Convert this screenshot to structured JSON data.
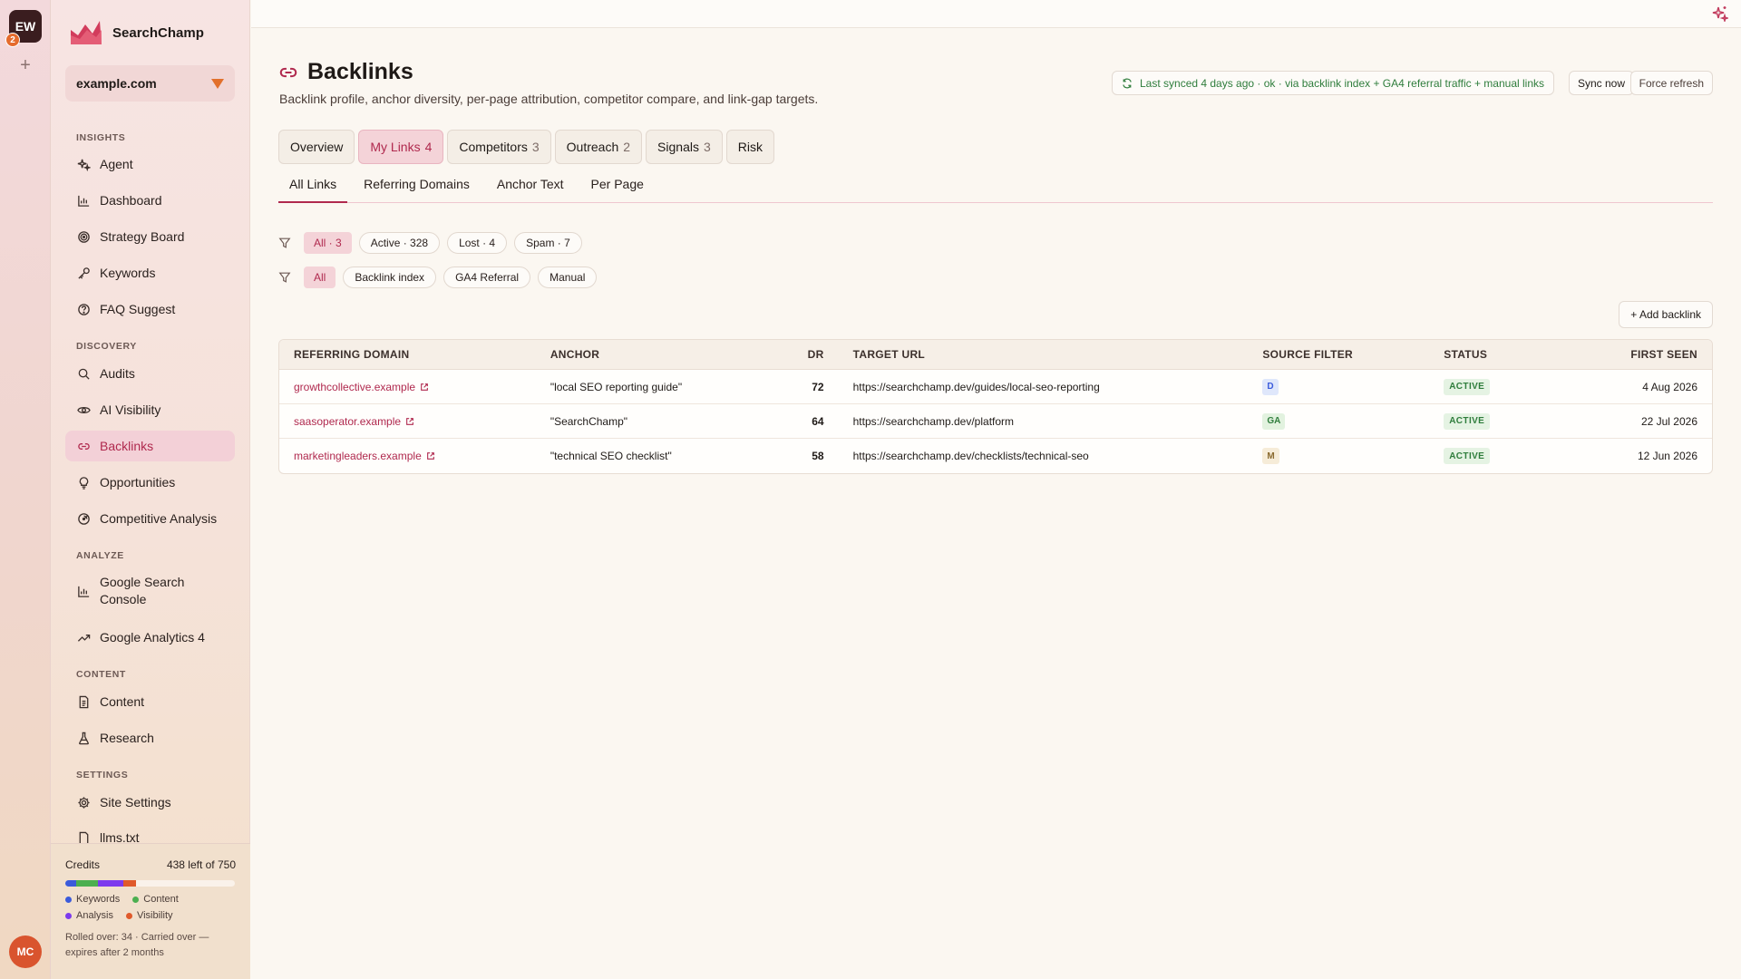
{
  "workspace": {
    "initials": "EW",
    "notifications": "2"
  },
  "user": {
    "initials": "MC"
  },
  "brand": {
    "name": "SearchChamp"
  },
  "site": {
    "selected": "example.com"
  },
  "nav": {
    "insights_label": "INSIGHTS",
    "discovery_label": "DISCOVERY",
    "analyze_label": "ANALYZE",
    "content_label": "CONTENT",
    "settings_label": "SETTINGS",
    "agent": "Agent",
    "dashboard": "Dashboard",
    "strategy": "Strategy Board",
    "keywords": "Keywords",
    "faq": "FAQ Suggest",
    "audits": "Audits",
    "ai_visibility": "AI Visibility",
    "backlinks": "Backlinks",
    "opportunities": "Opportunities",
    "competitive": "Competitive Analysis",
    "gsc_line1": "Google Search",
    "gsc_line2": "Console",
    "ga4": "Google Analytics 4",
    "content": "Content",
    "research": "Research",
    "site_settings": "Site Settings",
    "llms": "llms.txt"
  },
  "credits": {
    "label": "Credits",
    "remaining": "438 left of 750",
    "segments": [
      {
        "name": "Keywords",
        "fraction": 0.063,
        "color": "#3b5bdb"
      },
      {
        "name": "Content",
        "fraction": 0.127,
        "color": "#4caf50"
      },
      {
        "name": "Analysis",
        "fraction": 0.153,
        "color": "#7c3aed"
      },
      {
        "name": "Visibility",
        "fraction": 0.073,
        "color": "#e05a2b"
      }
    ],
    "legend": {
      "keywords": "Keywords",
      "content": "Content",
      "analysis": "Analysis",
      "visibility": "Visibility"
    },
    "note_line1": "Rolled over: 34 · Carried over —",
    "note_line2": "expires after 2 months"
  },
  "page": {
    "title": "Backlinks",
    "subtitle": "Backlink profile, anchor diversity, per-page attribution, competitor compare, and link-gap targets.",
    "sync_status": "Last synced 4 days ago · ok · via backlink index + GA4 referral traffic + manual links",
    "sync_button": "Sync now",
    "force_button": "Force refresh",
    "add_button": "+ Add backlink"
  },
  "tabs": [
    {
      "label": "Overview",
      "count": ""
    },
    {
      "label": "My Links",
      "count": "4"
    },
    {
      "label": "Competitors",
      "count": "3"
    },
    {
      "label": "Outreach",
      "count": "2"
    },
    {
      "label": "Signals",
      "count": "3"
    },
    {
      "label": "Risk",
      "count": ""
    }
  ],
  "subtabs": [
    "All Links",
    "Referring Domains",
    "Anchor Text",
    "Per Page"
  ],
  "status_filters": [
    "All · 3",
    "Active · 328",
    "Lost · 4",
    "Spam · 7"
  ],
  "source_filters": [
    "All",
    "Backlink index",
    "GA4 Referral",
    "Manual"
  ],
  "table": {
    "headers": {
      "domain": "REFERRING DOMAIN",
      "anchor": "ANCHOR",
      "dr": "DR",
      "url": "TARGET URL",
      "source": "SOURCE FILTER",
      "status": "STATUS",
      "seen": "FIRST SEEN"
    },
    "rows": [
      {
        "domain": "growthcollective.example",
        "anchor": "\"local SEO reporting guide\"",
        "dr": "72",
        "url": "https://searchchamp.dev/guides/local-seo-reporting",
        "source": "D",
        "status": "ACTIVE",
        "seen": "4 Aug 2026"
      },
      {
        "domain": "saasoperator.example",
        "anchor": "\"SearchChamp\"",
        "dr": "64",
        "url": "https://searchchamp.dev/platform",
        "source": "GA",
        "status": "ACTIVE",
        "seen": "22 Jul 2026"
      },
      {
        "domain": "marketingleaders.example",
        "anchor": "\"technical SEO checklist\"",
        "dr": "58",
        "url": "https://searchchamp.dev/checklists/technical-seo",
        "source": "M",
        "status": "ACTIVE",
        "seen": "12 Jun 2026"
      }
    ]
  },
  "colors": {
    "accent": "#b0294e",
    "source_d_bg": "#dfe7fb",
    "source_d_fg": "#3b5bdb",
    "source_ga_bg": "#e2f2df",
    "source_ga_fg": "#2f7d3c",
    "source_m_bg": "#f6ecd8",
    "source_m_fg": "#8a6a2f"
  }
}
